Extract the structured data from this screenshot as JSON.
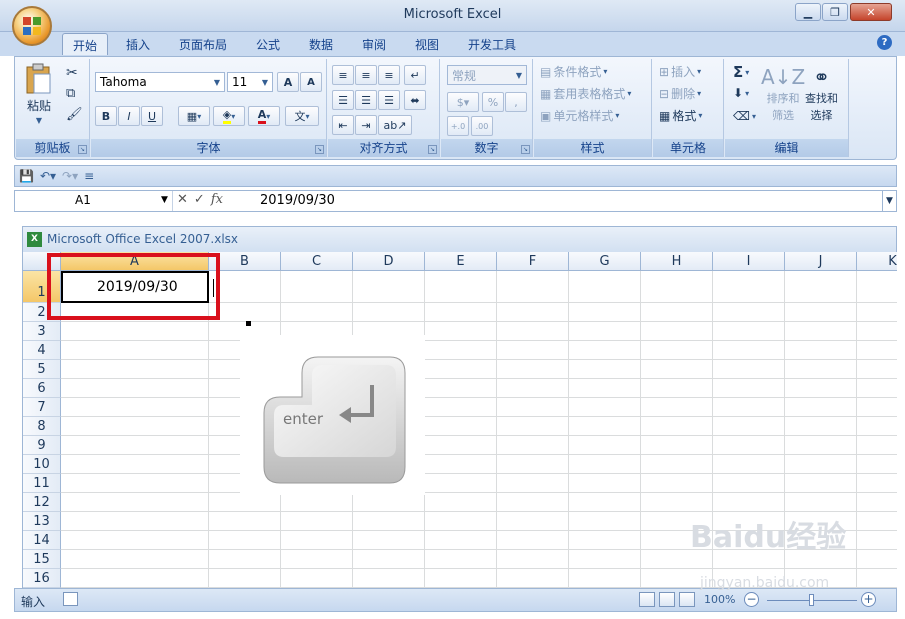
{
  "window": {
    "title": "Microsoft Excel"
  },
  "tabs": [
    "开始",
    "插入",
    "页面布局",
    "公式",
    "数据",
    "审阅",
    "视图",
    "开发工具"
  ],
  "ribbon": {
    "clipboard": {
      "label": "剪贴板",
      "paste": "粘贴"
    },
    "font": {
      "label": "字体",
      "font_name": "Tahoma",
      "font_size": "11",
      "bold": "B",
      "italic": "I",
      "underline": "U",
      "grow": "A",
      "shrink": "A",
      "font_color": "A"
    },
    "alignment": {
      "label": "对齐方式"
    },
    "number": {
      "label": "数字",
      "format": "常规",
      "percent": "%"
    },
    "styles": {
      "label": "样式",
      "conditional": "条件格式",
      "table": "套用表格格式",
      "cell_styles": "单元格样式"
    },
    "cells": {
      "label": "单元格",
      "insert": "插入",
      "delete": "删除",
      "format": "格式"
    },
    "editing": {
      "label": "编辑",
      "sum": "Σ",
      "sort_l1": "排序和",
      "sort_l2": "筛选",
      "find_l1": "查找和",
      "find_l2": "选择"
    }
  },
  "formula_bar": {
    "name_box": "A1",
    "fx": "fx",
    "value": "2019/09/30"
  },
  "workbook": {
    "title": "Microsoft Office Excel 2007.xlsx"
  },
  "columns": [
    "A",
    "B",
    "C",
    "D",
    "E",
    "F",
    "G",
    "H",
    "I",
    "J",
    "K"
  ],
  "rows": [
    "1",
    "2",
    "3",
    "4",
    "5",
    "6",
    "7",
    "8",
    "9",
    "10",
    "11",
    "12",
    "13",
    "14",
    "15",
    "16"
  ],
  "cell_a1": "2019/09/30",
  "key_image": {
    "text": "enter"
  },
  "status": {
    "mode": "输入",
    "zoom": "100%"
  },
  "watermark": {
    "brand": "Baidu经验",
    "url": "jingyan.baidu.com"
  },
  "colors": {
    "highlight": "#d9101c",
    "ribbon": "#dae6f5",
    "selected_header": "#f4c768"
  }
}
